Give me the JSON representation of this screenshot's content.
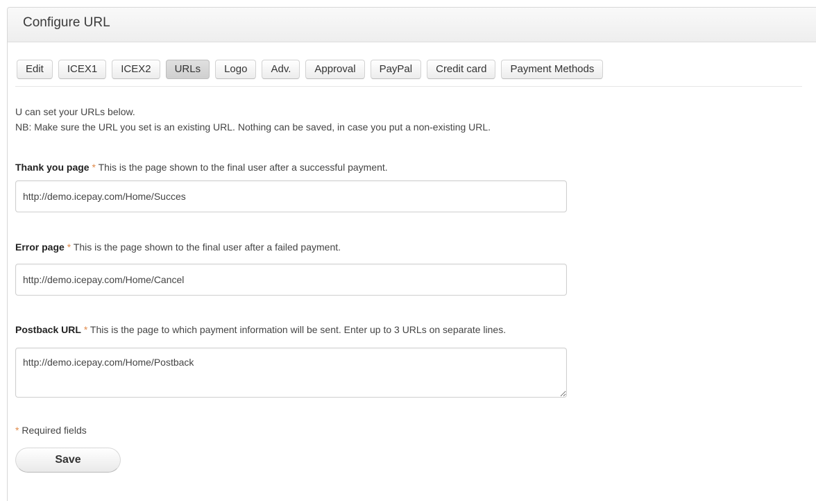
{
  "panel": {
    "title": "Configure URL"
  },
  "tabs": [
    {
      "label": "Edit",
      "active": false
    },
    {
      "label": "ICEX1",
      "active": false
    },
    {
      "label": "ICEX2",
      "active": false
    },
    {
      "label": "URLs",
      "active": true
    },
    {
      "label": "Logo",
      "active": false
    },
    {
      "label": "Adv.",
      "active": false
    },
    {
      "label": "Approval",
      "active": false
    },
    {
      "label": "PayPal",
      "active": false
    },
    {
      "label": "Credit card",
      "active": false
    },
    {
      "label": "Payment Methods",
      "active": false
    }
  ],
  "intro": {
    "line1": "U can set your URLs below.",
    "line2": "NB: Make sure the URL you set is an existing URL. Nothing can be saved, in case you put a non-existing URL."
  },
  "fields": {
    "thank_you": {
      "label": "Thank you page",
      "star": "*",
      "description": "This is the page shown to the final user after a successful payment.",
      "value": "http://demo.icepay.com/Home/Succes"
    },
    "error": {
      "label": "Error page",
      "star": "*",
      "description": "This is the page shown to the final user after a failed payment.",
      "value": "http://demo.icepay.com/Home/Cancel"
    },
    "postback": {
      "label": "Postback URL",
      "star": "*",
      "description": "This is the page to which payment information will be sent. Enter up to 3 URLs on separate lines.",
      "value": "http://demo.icepay.com/Home/Postback"
    }
  },
  "required_note": {
    "star": "*",
    "text": "Required fields"
  },
  "save_label": "Save",
  "colors": {
    "required_star": "#e08a4a",
    "active_tab": "#d6d6d6"
  }
}
